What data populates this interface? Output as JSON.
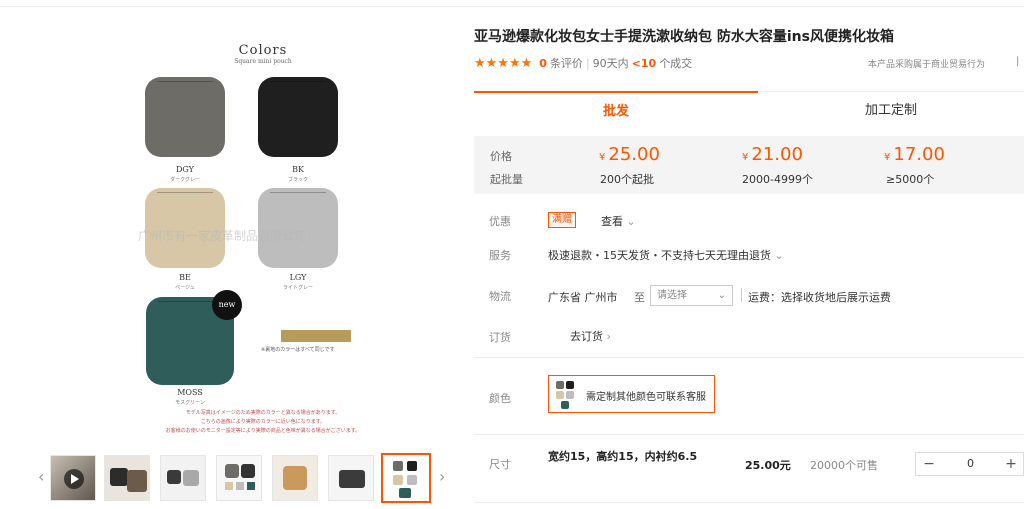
{
  "product": {
    "title": "亚马逊爆款化妆包女士手提洗漱收纳包 防水大容量ins风便携化妆箱",
    "stars": "★★★★★",
    "review_count": "0",
    "review_label": "条评价",
    "sales_period": "90天内",
    "sales_count": "<10",
    "sales_label": "个成交",
    "purchase_note": "本产品采购属于商业贸易行为",
    "purchase_flag": "|"
  },
  "tabs": [
    {
      "label": "批发",
      "active": true
    },
    {
      "label": "加工定制",
      "active": false
    }
  ],
  "pricing": {
    "price_label": "价格",
    "moq_label": "起批量",
    "currency": "¥",
    "tiers": [
      {
        "price": "25.00",
        "qty": "200个起批"
      },
      {
        "price": "21.00",
        "qty": "2000-4999个"
      },
      {
        "price": "17.00",
        "qty": "≥5000个"
      }
    ]
  },
  "promo": {
    "label": "优惠",
    "badge": "满赠",
    "link": "查看"
  },
  "service": {
    "label": "服务",
    "text": "极速退款・15天发货・不支持七天无理由退货"
  },
  "logistics": {
    "label": "物流",
    "origin": "广东省 广州市",
    "to": "至",
    "select_placeholder": "请选择",
    "fee": "运费：选择收货地后展示运费"
  },
  "order": {
    "label": "订货",
    "link": "去订货"
  },
  "color": {
    "label": "颜色",
    "option": "需定制其他颜色可联系客服"
  },
  "size": {
    "label": "尺寸",
    "spec": "宽约15，高约15，内衬约6.5",
    "price": "25.00元",
    "available": "20000个可售",
    "quantity": "0",
    "minus": "−",
    "plus": "+"
  },
  "gallery": {
    "heading": "Colors",
    "subheading": "Square mini pouch",
    "items": [
      {
        "code": "DGY",
        "jp": "ダークグレー",
        "color": "#6e6c66"
      },
      {
        "code": "BK",
        "jp": "ブラック",
        "color": "#1f1f1f"
      },
      {
        "code": "BE",
        "jp": "ベージュ",
        "color": "#d8c7a7"
      },
      {
        "code": "LGY",
        "jp": "ライトグレー",
        "color": "#bdbdbd"
      },
      {
        "code": "MOSS",
        "jp": "モスグリーン",
        "color": "#2f5d5a"
      }
    ],
    "new_badge": "new",
    "swatch_note": "※裏地のカラーはすべて同じです",
    "swatch_color": "#b89a5a",
    "jp_notes": [
      "モデル写真はイメージのため実際のカラーと異なる場合があります。",
      "こちらの画像により実際のカラーに近い色になります。",
      "お客様のお使いのモニター設定等により実際の商品と色味が異なる場合がございます。"
    ],
    "watermark": "广州市有一家皮革制品有限公司",
    "prev": "‹",
    "next": "›"
  },
  "colors": {
    "accent": "#ff5500",
    "star": "#ff7300"
  }
}
